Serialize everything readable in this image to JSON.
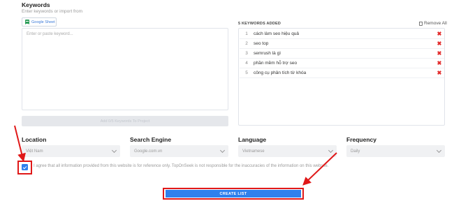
{
  "keywords": {
    "title": "Keywords",
    "subtitle": "Enter keywords or import from",
    "google_sheet_label": "Google Sheet",
    "textarea_placeholder": "Enter or paste keyword...",
    "add_button_label": "Add 0/5 Keywords To Project"
  },
  "added_list": {
    "title": "5 KEYWORDS ADDED",
    "remove_all_label": "Remove All",
    "items": [
      {
        "num": "1",
        "text": "cách làm seo hiệu quả"
      },
      {
        "num": "2",
        "text": "seo top"
      },
      {
        "num": "3",
        "text": "semrush là gì"
      },
      {
        "num": "4",
        "text": "phần mềm hỗ trợ seo"
      },
      {
        "num": "5",
        "text": "công cụ phân tích từ khóa"
      }
    ],
    "delete_glyph": "✖"
  },
  "fields": {
    "location": {
      "label": "Location",
      "value": "Việt Nam"
    },
    "search_engine": {
      "label": "Search Engine",
      "value": "Google.com.vn"
    },
    "language": {
      "label": "Language",
      "value": "Vietnamese"
    },
    "frequency": {
      "label": "Frequency",
      "value": "Daily"
    }
  },
  "agreement": {
    "checked": true,
    "text": "I agree that all information provided from this website is for reference only. TopOnSeek is not responsible for the inaccuracies of the information on this website."
  },
  "create_button_label": "CREATE LIST",
  "colors": {
    "accent": "#2f80ed",
    "annotation_red": "#e01818",
    "delete_red": "#e22929"
  }
}
